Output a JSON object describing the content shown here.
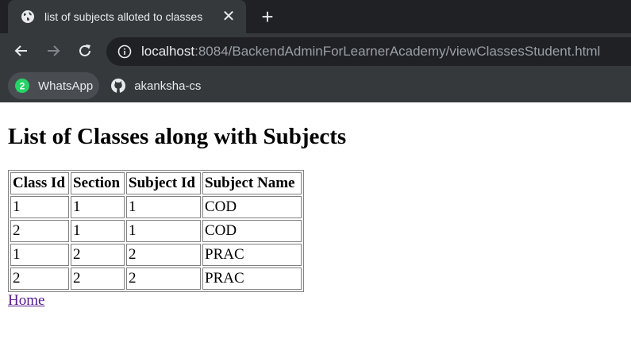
{
  "browser": {
    "tab": {
      "title": "list of subjects alloted to classes",
      "close_glyph": "✕"
    },
    "new_tab_glyph": "+",
    "omnibox": {
      "host": "localhost",
      "rest": ":8084/BackendAdminForLearnerAcademy/viewClassesStudent.html"
    },
    "bookmarks": [
      {
        "label": "WhatsApp",
        "icon": "whatsapp-icon",
        "badge": "2"
      },
      {
        "label": "akanksha-cs",
        "icon": "github-icon"
      }
    ],
    "colors": {
      "tabstrip": "#202124",
      "toolbar": "#35393c",
      "omnibox": "#202124"
    }
  },
  "page": {
    "heading": "List of Classes along with Subjects",
    "table": {
      "headers": [
        "Class Id",
        "Section",
        "Subject Id",
        "Subject Name"
      ],
      "rows": [
        [
          "1",
          "1",
          "1",
          "COD"
        ],
        [
          "2",
          "1",
          "1",
          "COD"
        ],
        [
          "1",
          "2",
          "2",
          "PRAC"
        ],
        [
          "2",
          "2",
          "2",
          "PRAC"
        ]
      ]
    },
    "home_link": "Home"
  }
}
